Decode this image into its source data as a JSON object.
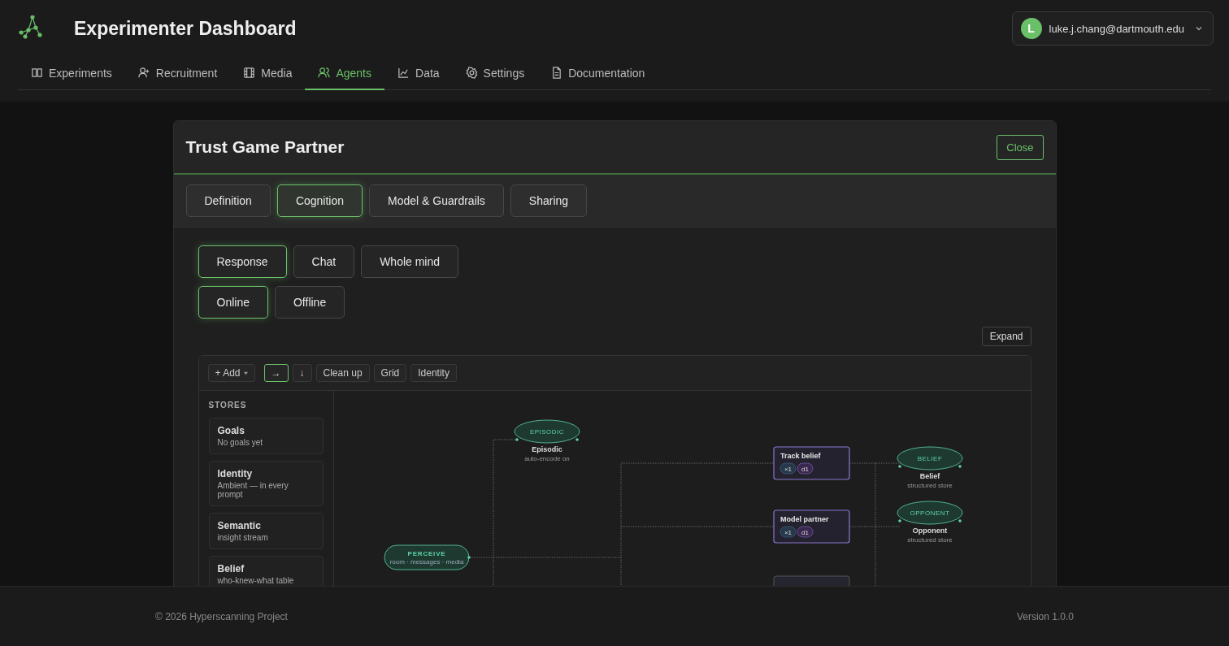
{
  "header": {
    "title": "Experimenter Dashboard",
    "user": {
      "initial": "L",
      "email": "luke.j.chang@dartmouth.edu"
    }
  },
  "nav": [
    {
      "label": "Experiments",
      "selected": false
    },
    {
      "label": "Recruitment",
      "selected": false
    },
    {
      "label": "Media",
      "selected": false
    },
    {
      "label": "Agents",
      "selected": true
    },
    {
      "label": "Data",
      "selected": false
    },
    {
      "label": "Settings",
      "selected": false
    },
    {
      "label": "Documentation",
      "selected": false
    }
  ],
  "card": {
    "title": "Trust Game Partner",
    "close": "Close",
    "tabs": [
      {
        "label": "Definition",
        "selected": false
      },
      {
        "label": "Cognition",
        "selected": true
      },
      {
        "label": "Model & Guardrails",
        "selected": false
      },
      {
        "label": "Sharing",
        "selected": false
      }
    ],
    "views": [
      {
        "label": "Response",
        "selected": true
      },
      {
        "label": "Chat",
        "selected": false
      },
      {
        "label": "Whole mind",
        "selected": false
      }
    ],
    "modes": [
      {
        "label": "Online",
        "selected": true
      },
      {
        "label": "Offline",
        "selected": false
      }
    ],
    "expand": "Expand",
    "editor": {
      "add": "+ Add",
      "directions": [
        {
          "label": "→",
          "selected": true
        },
        {
          "label": "↓",
          "selected": false
        }
      ],
      "tools": [
        "Clean up",
        "Grid",
        "Identity"
      ],
      "stores_heading": "STORES",
      "stores": [
        {
          "name": "Goals",
          "detail": "No goals yet"
        },
        {
          "name": "Identity",
          "detail": "Ambient — in every prompt"
        },
        {
          "name": "Semantic",
          "detail": "insight stream"
        },
        {
          "name": "Belief",
          "detail": "who-knew-what table"
        }
      ],
      "nodes": [
        {
          "kind": "process",
          "label": "PERCEIVE",
          "sub": "room · messages · media"
        },
        {
          "kind": "store",
          "tag": "EPISODIC",
          "label": "Episodic",
          "sub": "auto-encode on"
        },
        {
          "kind": "step",
          "label": "Track belief",
          "chips": [
            "×1",
            "d1"
          ]
        },
        {
          "kind": "step",
          "label": "Model partner",
          "chips": [
            "×1",
            "d1"
          ]
        },
        {
          "kind": "store",
          "tag": "BELIEF",
          "label": "Belief",
          "sub": "structured store"
        },
        {
          "kind": "store",
          "tag": "OPPONENT",
          "label": "Opponent",
          "sub": "structured store"
        }
      ]
    }
  },
  "footer": {
    "copyright": "© 2026 Hyperscanning Project",
    "version": "Version 1.0.0"
  }
}
